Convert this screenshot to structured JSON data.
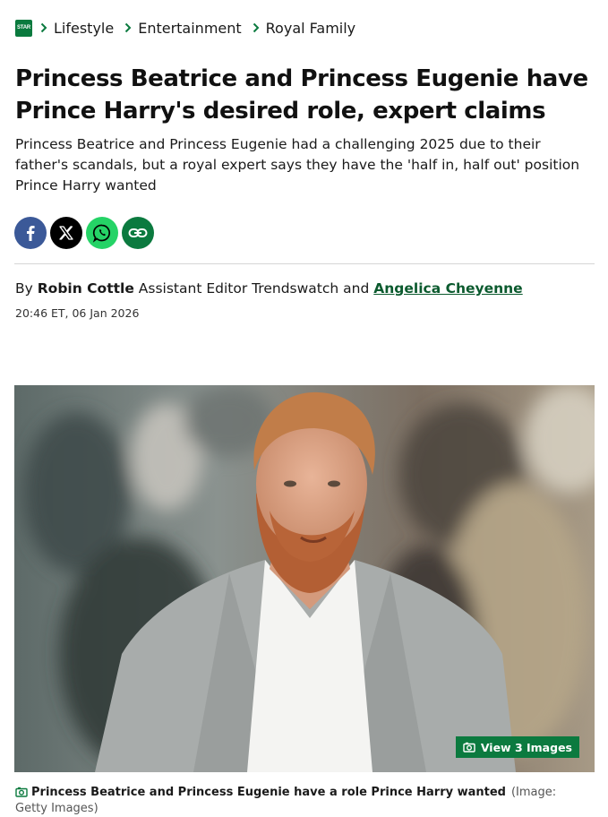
{
  "breadcrumb": {
    "logo_text": "STAR",
    "items": [
      {
        "label": "Lifestyle"
      },
      {
        "label": "Entertainment"
      },
      {
        "label": "Royal Family"
      }
    ]
  },
  "article": {
    "headline": "Princess Beatrice and Princess Eugenie have Prince Harry's desired role, expert claims",
    "standfirst": "Princess Beatrice and Princess Eugenie had a challenging 2025 due to their father's scandals, but a royal expert says they have the 'half in, half out' position Prince Harry wanted",
    "byline": {
      "prefix": "By",
      "author1": "Robin Cottle",
      "role": "Assistant Editor Trendswatch",
      "conj": "and",
      "author2": "Angelica Cheyenne"
    },
    "date": "20:46 ET, 06 Jan 2026"
  },
  "share": {
    "icons": [
      "facebook-icon",
      "x-icon",
      "whatsapp-icon",
      "link-icon"
    ],
    "colors": {
      "facebook": "#3b5998",
      "x": "#000000",
      "whatsapp": "#25d366",
      "link": "#0b7a3f"
    }
  },
  "image": {
    "view_label": "View 3 Images",
    "caption": "Princess Beatrice and Princess Eugenie have a role Prince Harry wanted",
    "credit": "(Image: Getty Images)"
  },
  "colors": {
    "accent": "#0b7a3f",
    "link": "#0b5a2e"
  }
}
